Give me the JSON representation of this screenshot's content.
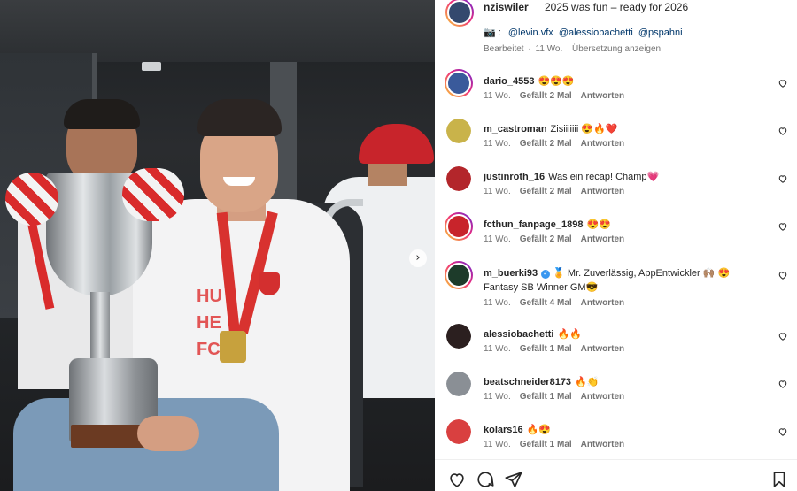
{
  "photo": {
    "next_icon": "chevron-right-icon",
    "next_glyph": "›",
    "hoodie_print": "HU HE FC"
  },
  "post": {
    "author": "nziswiler",
    "caption": "2025 was fun – ready for 2026",
    "credits_icon": "camera-emoji",
    "credits_prefix": "📷 :",
    "credits_mentions": [
      "@levin.vfx",
      "@alessiobachetti",
      "@pspahni"
    ],
    "meta_edited": "Bearbeitet",
    "meta_sep": "·",
    "meta_time": "11 Wo.",
    "meta_translate": "Übersetzung anzeigen"
  },
  "comments": [
    {
      "user": "dario_4553",
      "text": "😍😍😍",
      "time": "11 Wo.",
      "likes": "Gefällt 2 Mal",
      "reply": "Antworten",
      "ring": true,
      "avatar_color": "#3a5a9b"
    },
    {
      "user": "m_castroman",
      "text": "Zisiiiiiii 😍🔥❤️",
      "time": "11 Wo.",
      "likes": "Gefällt 2 Mal",
      "reply": "Antworten",
      "ring": false,
      "avatar_color": "#c9b34a"
    },
    {
      "user": "justinroth_16",
      "text": "Was ein recap! Champ💗",
      "time": "11 Wo.",
      "likes": "Gefällt 2 Mal",
      "reply": "Antworten",
      "ring": false,
      "avatar_color": "#b3262b"
    },
    {
      "user": "fcthun_fanpage_1898",
      "text": "😍😍",
      "time": "11 Wo.",
      "likes": "Gefällt 2 Mal",
      "reply": "Antworten",
      "ring": true,
      "avatar_color": "#c8242b"
    },
    {
      "user": "m_buerki93",
      "verified": true,
      "text": "🏅 Mr. Zuverlässig, AppEntwickler 🙌🏽 😍",
      "text2": "Fantasy SB Winner GM😎",
      "time": "11 Wo.",
      "likes": "Gefällt 4 Mal",
      "reply": "Antworten",
      "ring": true,
      "avatar_color": "#1d3b2a"
    },
    {
      "user": "alessiobachetti",
      "text": "🔥🔥",
      "time": "11 Wo.",
      "likes": "Gefällt 1 Mal",
      "reply": "Antworten",
      "ring": false,
      "avatar_color": "#2b1f1f"
    },
    {
      "user": "beatschneider8173",
      "text": "🔥👏",
      "time": "11 Wo.",
      "likes": "Gefällt 1 Mal",
      "reply": "Antworten",
      "ring": false,
      "avatar_color": "#8a8f95"
    },
    {
      "user": "kolars16",
      "text": "🔥😍",
      "time": "11 Wo.",
      "likes": "Gefällt 1 Mal",
      "reply": "Antworten",
      "ring": false,
      "avatar_color": "#d94040"
    }
  ],
  "actions": {
    "like_icon": "heart-icon",
    "comment_icon": "comment-icon",
    "share_icon": "send-icon",
    "save_icon": "bookmark-icon"
  },
  "colors": {
    "text": "#262626",
    "muted": "#737373",
    "link": "#00376b",
    "verified": "#3897f0"
  }
}
